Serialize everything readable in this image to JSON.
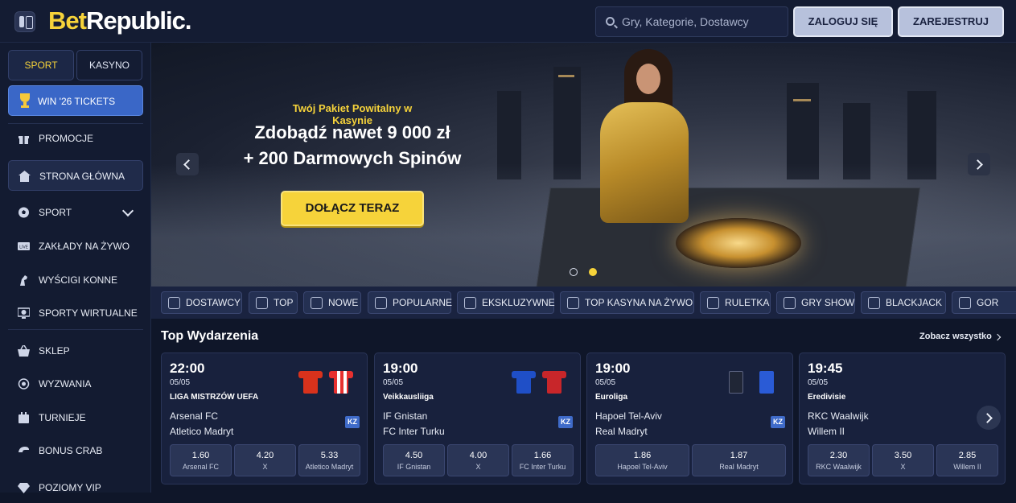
{
  "header": {
    "logo_bet": "Bet",
    "logo_rest": "Republic.",
    "search_placeholder": "Gry, Kategorie, Dostawcy",
    "login_label": "ZALOGUJ SIĘ",
    "register_label": "ZAREJESTRUJ"
  },
  "sidebar": {
    "tab_sport": "SPORT",
    "tab_kasyno": "KASYNO",
    "win_tickets": "WIN '26 TICKETS",
    "items": [
      {
        "label": "PROMOCJE",
        "icon": "gift-icon"
      },
      {
        "label": "STRONA GŁÓWNA",
        "icon": "home-icon",
        "active": true
      },
      {
        "label": "SPORT",
        "icon": "soccer-ball-icon",
        "expandable": true
      },
      {
        "label": "ZAKŁADY NA ŻYWO",
        "icon": "live-icon"
      },
      {
        "label": "WYŚCIGI KONNE",
        "icon": "horse-icon"
      },
      {
        "label": "SPORTY WIRTUALNE",
        "icon": "virtual-sports-icon"
      },
      {
        "label": "SKLEP",
        "icon": "basket-icon"
      },
      {
        "label": "WYZWANIA",
        "icon": "challenge-icon"
      },
      {
        "label": "TURNIEJE",
        "icon": "tournament-icon"
      },
      {
        "label": "BONUS CRAB",
        "icon": "crab-icon"
      },
      {
        "label": "POZIOMY VIP",
        "icon": "diamond-icon"
      }
    ]
  },
  "hero": {
    "subtitle": "Twój Pakiet Powitalny w Kasynie",
    "title_line1": "Zdobądź nawet 9 000 zł",
    "title_line2": "+ 200 Darmowych Spinów",
    "cta": "DOŁĄCZ TERAZ"
  },
  "categories": [
    {
      "label": "DOSTAWCY",
      "icon": "providers-icon"
    },
    {
      "label": "TOP",
      "icon": "crown-icon"
    },
    {
      "label": "NOWE",
      "icon": "lightning-icon"
    },
    {
      "label": "POPULARNE",
      "icon": "flame-icon"
    },
    {
      "label": "EKSKLUZYWNE",
      "icon": "diamond-icon"
    },
    {
      "label": "TOP KASYNA NA ŻYWO",
      "icon": "star-icon"
    },
    {
      "label": "RULETKA",
      "icon": "roulette-icon"
    },
    {
      "label": "GRY SHOW",
      "icon": "microphone-icon"
    },
    {
      "label": "BLACKJACK",
      "icon": "cards-icon"
    },
    {
      "label": "GOR",
      "icon": "hot-icon"
    }
  ],
  "events": {
    "title": "Top Wydarzenia",
    "see_all": "Zobacz wszystko",
    "cards": [
      {
        "time": "22:00",
        "date": "05/05",
        "league": "LIGA MISTRZÓW UEFA",
        "team1": "Arsenal FC",
        "team2": "Atletico Madryt",
        "badge": "KZ",
        "home_kit": "#d8321c",
        "away_kit": "#e7302f",
        "odds": [
          {
            "value": "1.60",
            "label": "Arsenal FC"
          },
          {
            "value": "4.20",
            "label": "X"
          },
          {
            "value": "5.33",
            "label": "Atletico Madryt"
          }
        ]
      },
      {
        "time": "19:00",
        "date": "05/05",
        "league": "Veikkausliiga",
        "team1": "IF Gnistan",
        "team2": "FC Inter Turku",
        "badge": "KZ",
        "home_kit": "#1f4fc7",
        "away_kit": "#c8262a",
        "odds": [
          {
            "value": "4.50",
            "label": "IF Gnistan"
          },
          {
            "value": "4.00",
            "label": "X"
          },
          {
            "value": "1.66",
            "label": "FC Inter Turku"
          }
        ]
      },
      {
        "time": "19:00",
        "date": "05/05",
        "league": "Euroliga",
        "team1": "Hapoel Tel-Aviv",
        "team2": "Real Madryt",
        "badge": "KZ",
        "home_kit": "#202636",
        "away_kit": "#2a5bd6",
        "odds": [
          {
            "value": "1.86",
            "label": "Hapoel Tel-Aviv"
          },
          {
            "value": "1.87",
            "label": "Real Madryt"
          }
        ]
      },
      {
        "time": "19:45",
        "date": "05/05",
        "league": "Eredivisie",
        "team1": "RKC Waalwijk",
        "team2": "Willem II",
        "odds": [
          {
            "value": "2.30",
            "label": "RKC Waalwijk"
          },
          {
            "value": "3.50",
            "label": "X"
          },
          {
            "value": "2.85",
            "label": "Willem II"
          }
        ]
      }
    ]
  }
}
